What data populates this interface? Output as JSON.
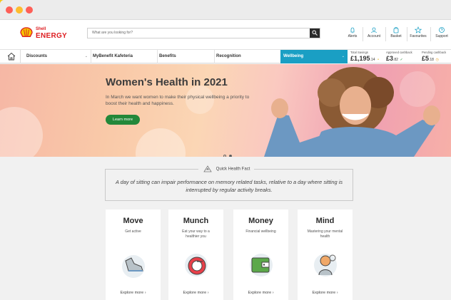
{
  "window": {
    "dots": [
      "close",
      "minimize",
      "zoom"
    ]
  },
  "brand": {
    "small": "Shell",
    "name": "ENERGY"
  },
  "search": {
    "placeholder": "What are you looking for?"
  },
  "user_menu": [
    {
      "label": "Alerts",
      "icon": "bell-icon"
    },
    {
      "label": "Account",
      "icon": "user-icon"
    },
    {
      "label": "Basket",
      "icon": "basket-icon"
    },
    {
      "label": "Favourites",
      "icon": "star-icon"
    },
    {
      "label": "Support",
      "icon": "help-icon"
    }
  ],
  "nav": {
    "items": [
      "Discounts",
      "MyBenefit Kafeteria",
      "Benefits",
      "Recognition",
      "Wellbeing"
    ],
    "stats": [
      {
        "label": "Total Savings",
        "value": "£1,195",
        "decimal": ".14"
      },
      {
        "label": "Approved cashback",
        "value": "£3",
        "decimal": ".82"
      },
      {
        "label": "Pending cashback",
        "value": "£5",
        "decimal": ".18"
      }
    ]
  },
  "hero": {
    "title": "Women's Health in 2021",
    "text": "In March we want women to make their physical wellbeing a priority to boost their health and happiness.",
    "cta": "Learn more"
  },
  "fact": {
    "label": "Quick Health Fact",
    "text": "A day of sitting can impair performance on memory related tasks, relative to a day where sitting is interrupted by regular activity breaks."
  },
  "cards": [
    {
      "title": "Move",
      "subtitle": "Get active",
      "cta": "Explore more"
    },
    {
      "title": "Munch",
      "subtitle": "Eat your way to a healthier you",
      "cta": "Explore more"
    },
    {
      "title": "Money",
      "subtitle": "Financial wellbeing",
      "cta": "Explore more"
    },
    {
      "title": "Mind",
      "subtitle": "Mastering your mental health",
      "cta": "Explore more"
    }
  ],
  "colors": {
    "accent": "#1a9fc4",
    "cta": "#23883a",
    "brand": "#dd1d21",
    "frame": "#f6c615"
  }
}
